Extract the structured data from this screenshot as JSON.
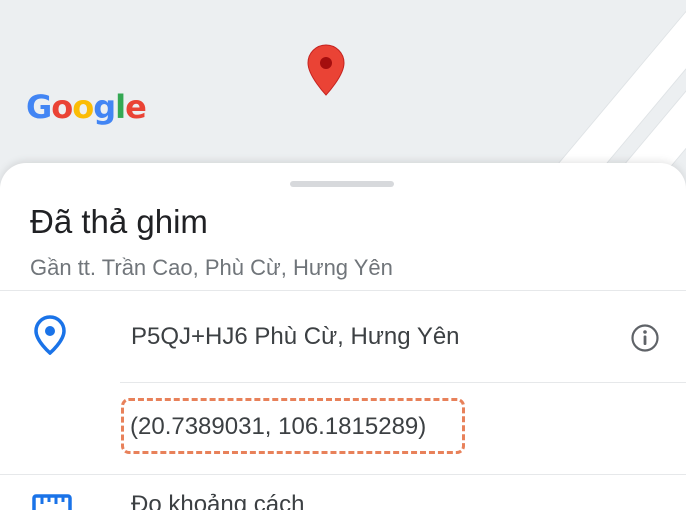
{
  "map": {
    "logo_letters": [
      "G",
      "o",
      "o",
      "g",
      "l",
      "e"
    ]
  },
  "sheet": {
    "title": "Đã thả ghim",
    "subtitle": "Gần tt. Trần Cao, Phù Cừ, Hưng Yên",
    "plus_code": "P5QJ+HJ6 Phù Cừ, Hưng Yên",
    "coordinates": "(20.7389031, 106.1815289)",
    "measure_label": "Đo khoảng cách"
  },
  "icons": {
    "map_pin": "map-pin-icon",
    "location": "location-pin-icon",
    "info": "info-icon",
    "ruler": "ruler-icon"
  },
  "colors": {
    "pin_red": "#ea4335",
    "accent_blue": "#1a73e8",
    "highlight_orange": "#e8815a"
  }
}
